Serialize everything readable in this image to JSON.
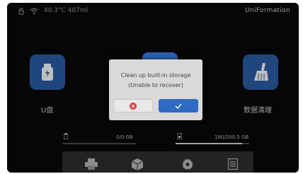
{
  "status_bar": {
    "temperature_and_volume": "40.3°C 407ml",
    "brand": "UniFormation",
    "icons": [
      "lock-icon",
      "wifi-icon"
    ]
  },
  "tiles": {
    "usb": {
      "label": "U盘",
      "icon": "usb-drive-icon"
    },
    "clean": {
      "label": "数据清理",
      "icon": "broom-icon"
    }
  },
  "storage": {
    "usb": {
      "text": "0/0 GB",
      "used_fraction": 0.0,
      "icon": "usb-small-icon"
    },
    "internal": {
      "text": "180/200.5 GB",
      "used_fraction": 0.9,
      "icon": "sd-card-icon"
    }
  },
  "bottom_nav": [
    {
      "icon": "printer-icon"
    },
    {
      "icon": "cube-icon"
    },
    {
      "icon": "settings-gear-icon"
    },
    {
      "icon": "file-icon"
    }
  ],
  "dialog": {
    "line1": "Clean up built-in storage",
    "line2": "(Unable to recover)",
    "cancel_icon": "cancel-icon",
    "confirm_icon": "checkmark-icon"
  },
  "colors": {
    "accent": "#2f6bc2",
    "tile": "#2b5ea9",
    "cancel_red": "#e0393e"
  }
}
